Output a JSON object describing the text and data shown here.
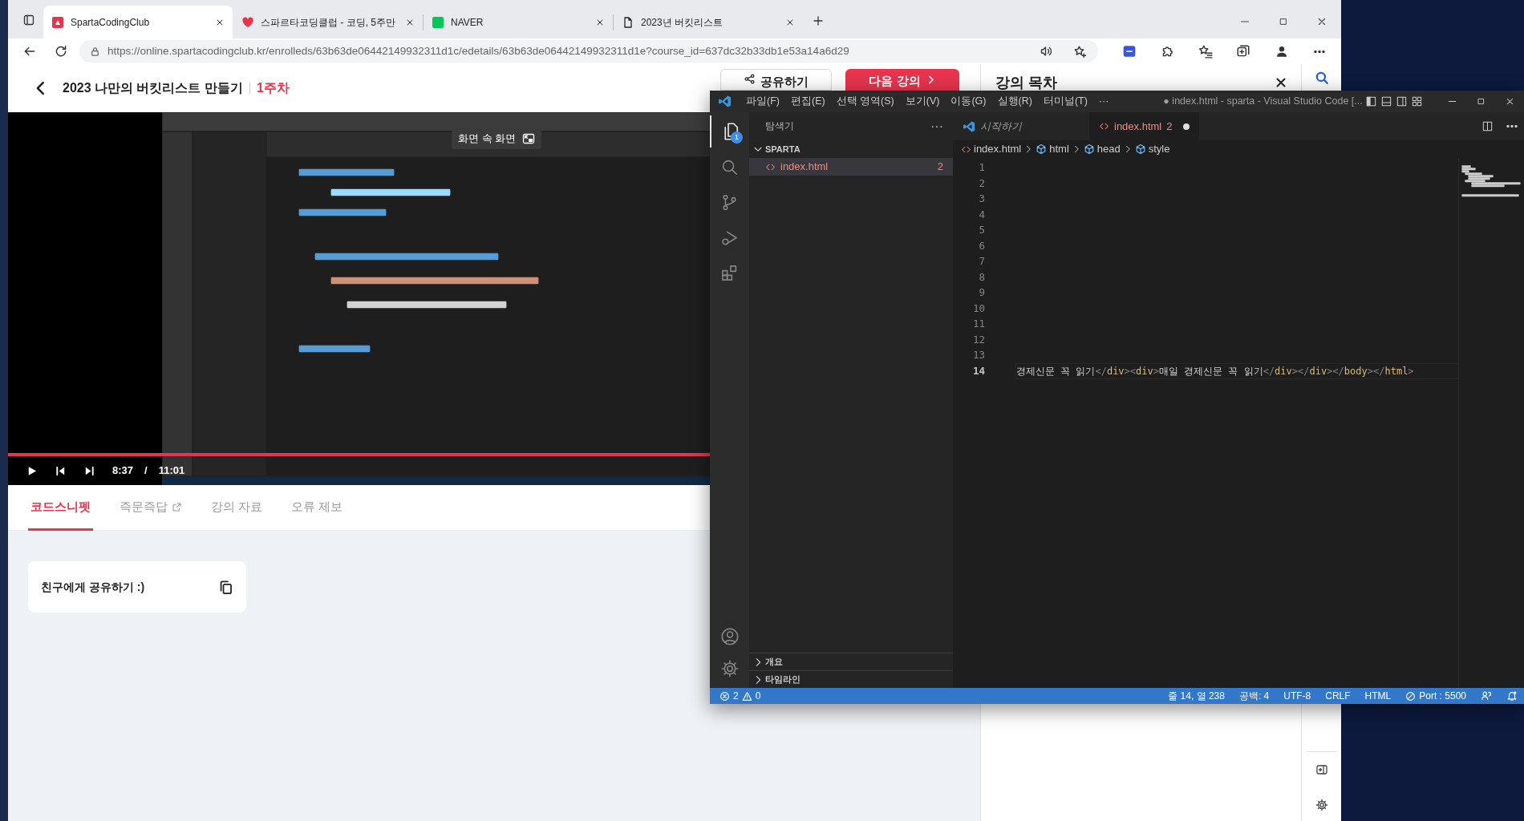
{
  "browser": {
    "tabs": [
      {
        "title": "SpartaCodingClub",
        "selected": true
      },
      {
        "title": "스파르타코딩클럽 - 코딩, 5주만",
        "selected": false
      },
      {
        "title": "NAVER",
        "selected": false
      },
      {
        "title": "2023년 버킷리스트",
        "selected": false
      }
    ],
    "address": "https://online.spartacodingclub.kr/enrolleds/63b63de06442149932311d1c/edetails/63b63de06442149932311d1e?course_id=637dc32b33db1e53a14a6d29"
  },
  "page": {
    "course_title": "2023 나만의 버킷리스트 만들기",
    "week": "1주차",
    "share_button": "공유하기",
    "next_button": "다음 강의",
    "video": {
      "pip_button": "화면 속 화면",
      "current_time": "8:37",
      "separator": "/",
      "duration": "11:01",
      "level": 1
    },
    "tabs": [
      {
        "label": "코드스니펫",
        "selected": true,
        "external": false
      },
      {
        "label": "즉문즉답",
        "selected": false,
        "external": true
      },
      {
        "label": "강의 자료",
        "selected": false,
        "external": false
      },
      {
        "label": "오류 제보",
        "selected": false,
        "external": false
      }
    ],
    "snippet_card": {
      "title": "친구에게 공유하기 :)"
    },
    "toc": {
      "title": "강의 목차"
    }
  },
  "vscode": {
    "menu": [
      "파일(F)",
      "편집(E)",
      "선택 영역(S)",
      "보기(V)",
      "이동(G)",
      "실행(R)",
      "터미널(T)",
      "···"
    ],
    "title": "● index.html - sparta - Visual Studio Code [...",
    "explorer_badge": "1",
    "sidebar": {
      "title": "탐색기",
      "more": "···",
      "folders": [
        {
          "label": "SPARTA",
          "expanded": true,
          "children": [
            {
              "label": "index.html",
              "badge": "2",
              "selected": true
            }
          ]
        }
      ],
      "panels": [
        {
          "label": "개요",
          "expanded": false
        },
        {
          "label": "타임라인",
          "expanded": false
        }
      ]
    },
    "tabs": [
      {
        "label": "시작하기",
        "kind": "welcome",
        "dirty": false,
        "selected": false
      },
      {
        "label": "index.html",
        "kind": "file",
        "problems": "2",
        "dirty": true,
        "selected": true
      }
    ],
    "breadcrumbs": [
      "index.html",
      "html",
      "head",
      "style"
    ],
    "lines": [
      {
        "number": "1",
        "current": false
      },
      {
        "number": "2",
        "current": false
      },
      {
        "number": "3",
        "current": false
      },
      {
        "number": "4",
        "current": false
      },
      {
        "number": "5",
        "current": false
      },
      {
        "number": "6",
        "current": false
      },
      {
        "number": "7",
        "current": false
      },
      {
        "number": "8",
        "current": false
      },
      {
        "number": "9",
        "current": false
      },
      {
        "number": "10",
        "current": false
      },
      {
        "number": "11",
        "current": false
      },
      {
        "number": "12",
        "current": false
      },
      {
        "number": "13",
        "current": false
      },
      {
        "number": "14",
        "current": true,
        "tokens": [
          {
            "kind": "text",
            "text": "경제신문 꼭 읽기"
          },
          {
            "kind": "punct",
            "text": "</"
          },
          {
            "kind": "tag",
            "text": "div"
          },
          {
            "kind": "punct",
            "text": "><"
          },
          {
            "kind": "tag",
            "text": "div"
          },
          {
            "kind": "punct",
            "text": ">"
          },
          {
            "kind": "text",
            "text": "매일 경제신문 꼭 읽기"
          },
          {
            "kind": "punct",
            "text": "</"
          },
          {
            "kind": "tag",
            "text": "div"
          },
          {
            "kind": "punct",
            "text": "></"
          },
          {
            "kind": "tag",
            "text": "div"
          },
          {
            "kind": "punct",
            "text": "></"
          },
          {
            "kind": "tag",
            "text": "body"
          },
          {
            "kind": "punct",
            "text": "></"
          },
          {
            "kind": "tag",
            "text": "html"
          },
          {
            "kind": "punct",
            "text": ">"
          }
        ]
      }
    ],
    "status": {
      "errors": "2",
      "warnings": "0",
      "items": [
        "줄 14, 열 238",
        "공백: 4",
        "UTF-8",
        "CRLF",
        "HTML"
      ],
      "port": "Port : 5500"
    }
  }
}
